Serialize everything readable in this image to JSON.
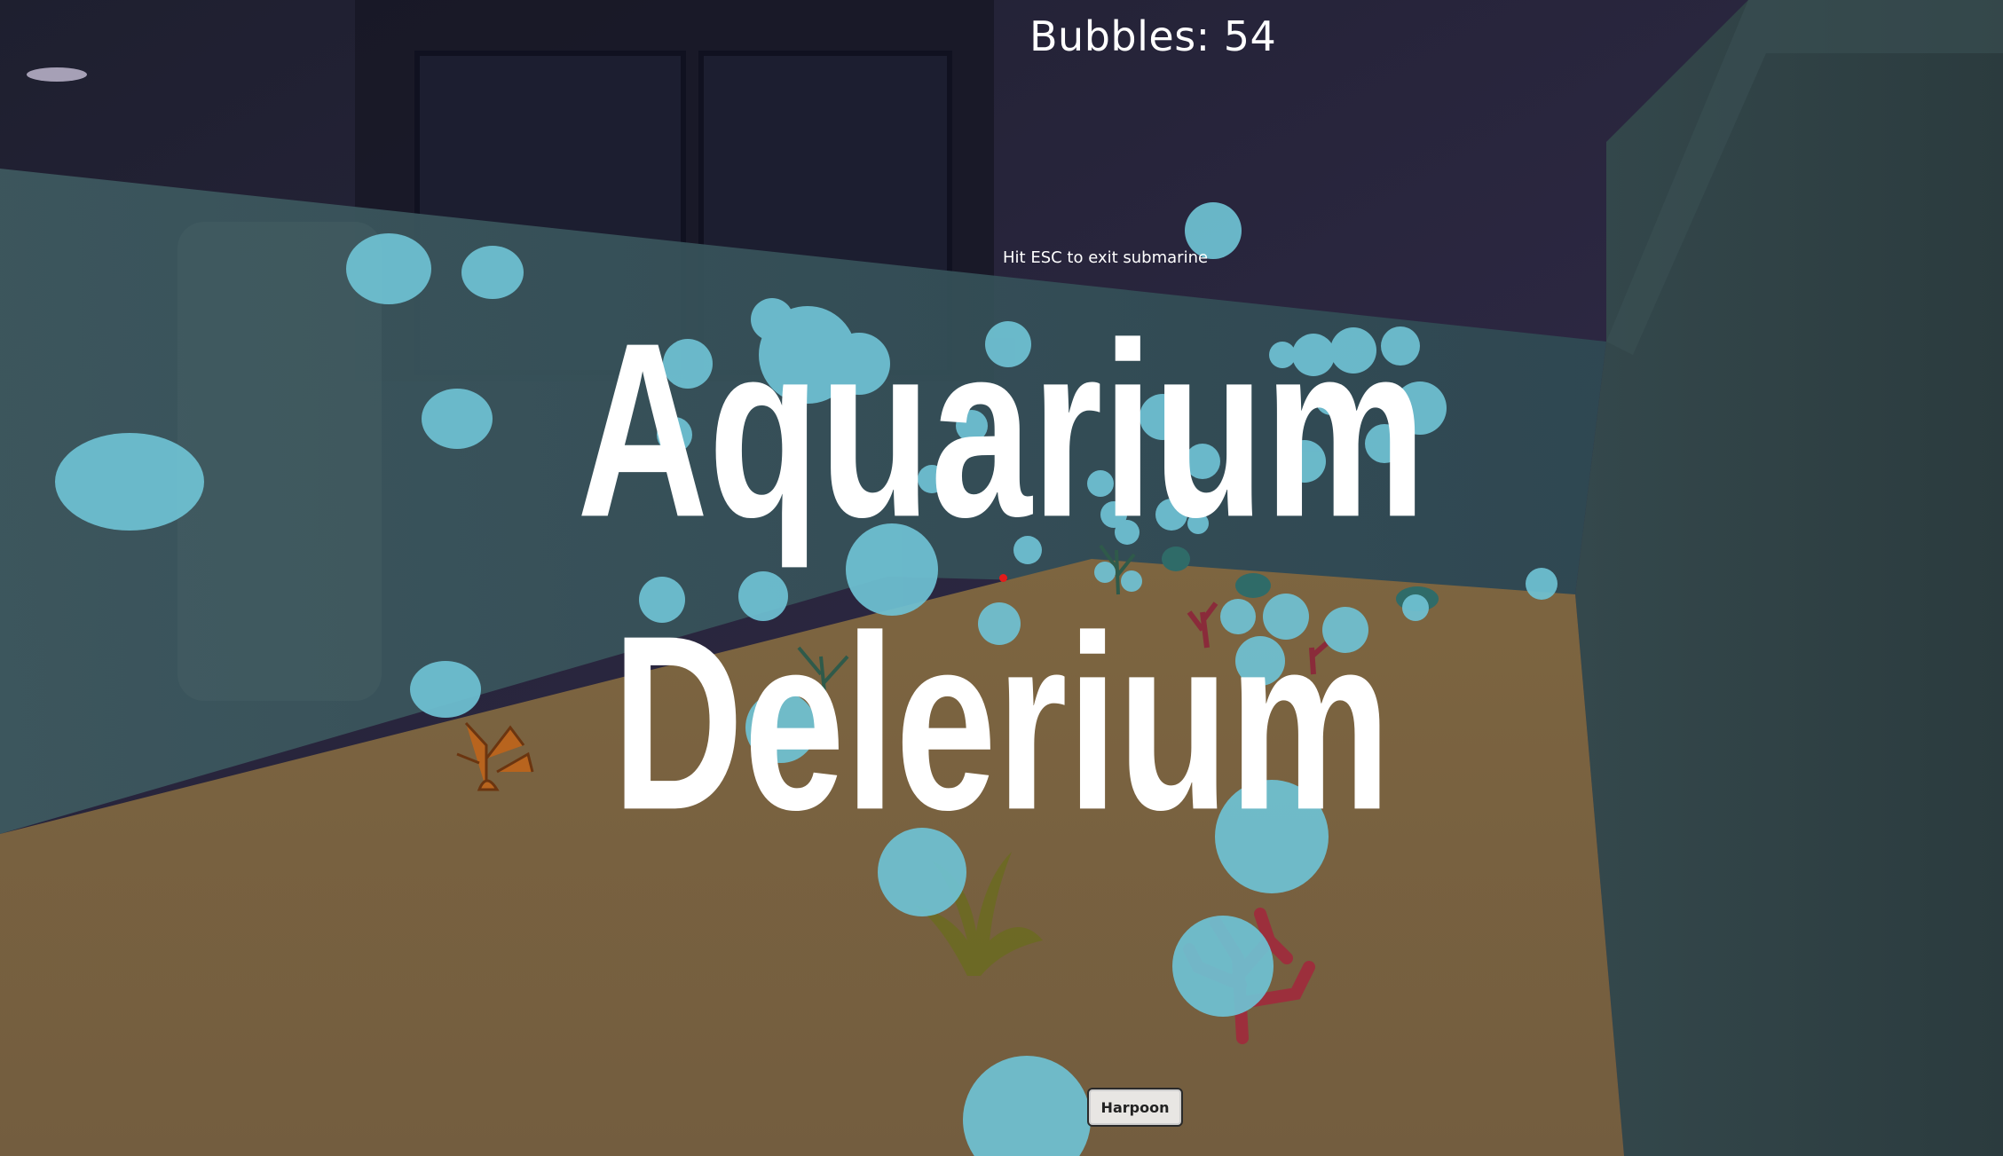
{
  "hud": {
    "bubbles_text": "Bubbles: 54",
    "hint": "Hit ESC to exit submarine"
  },
  "title": {
    "line1": "Aquarium",
    "line2": "Delerium"
  },
  "actions": {
    "harpoon_label": "Harpoon"
  },
  "colors": {
    "bubble": "#6fc2d4",
    "sand": "#7a6340",
    "glass": "#2f4a52",
    "wall": "#2e2a44",
    "cabinet": "#1b1d2c",
    "crosshair": "#e21b1b",
    "coral_red": "#9c2f3c",
    "coral_orange": "#b8641e",
    "seaweed": "#6b6a22",
    "plant_teal": "#2f6b68"
  }
}
